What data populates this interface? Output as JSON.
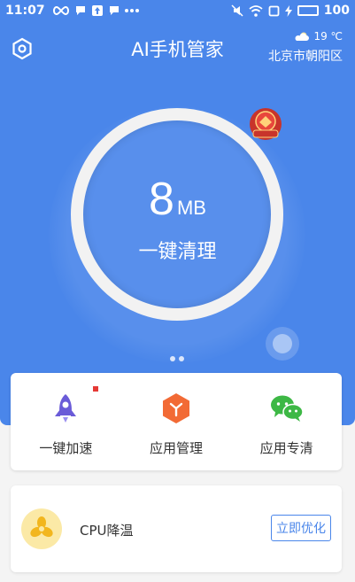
{
  "status_bar": {
    "time": "11:07",
    "battery_level": "100",
    "icons_left": [
      "infinity-icon",
      "chat-bubble-icon",
      "upload-icon",
      "chat-bubble-icon",
      "more-dots-icon"
    ],
    "icons_right": [
      "mute-icon",
      "wifi-icon",
      "tablet-icon",
      "charging-icon",
      "battery-icon"
    ]
  },
  "header": {
    "title": "AI手机管家",
    "settings_icon": "settings-hexagon-icon",
    "weather": {
      "icon": "cloud-sun-icon",
      "temperature": "19 ℃",
      "location": "北京市朝阳区"
    }
  },
  "cleaner": {
    "value": "8",
    "unit": "MB",
    "action_label": "一键清理",
    "badge_icon": "promo-badge-icon"
  },
  "pager": {
    "pages": 2,
    "current": 1
  },
  "tools": [
    {
      "label": "一键加速",
      "icon": "rocket-icon",
      "has_new_dot": true
    },
    {
      "label": "应用管理",
      "icon": "app-manage-hexagon-icon",
      "has_new_dot": false
    },
    {
      "label": "应用专清",
      "icon": "wechat-icon",
      "has_new_dot": false
    }
  ],
  "cpu_card": {
    "icon": "fan-icon",
    "title": "CPU降温",
    "button_label": "立即优化"
  },
  "colors": {
    "primary": "#4a86ea",
    "background": "#f4f4f4",
    "rocket": "#6a5bd8",
    "orange": "#f26a35",
    "wechat": "#3db845",
    "fan": "#f2b61e"
  }
}
